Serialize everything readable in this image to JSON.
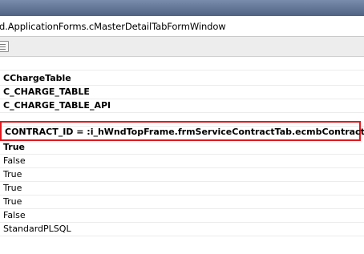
{
  "window": {
    "path": "d.ApplicationForms.cMasterDetailTabFormWindow"
  },
  "properties": {
    "rows_top": [
      {
        "value": "CChargeTable",
        "bold": true
      },
      {
        "value": "C_CHARGE_TABLE",
        "bold": true
      },
      {
        "value": "C_CHARGE_TABLE_API",
        "bold": true
      }
    ],
    "highlighted": "CONTRACT_ID = :i_hWndTopFrame.frmServiceContractTab.ecmbContractId",
    "rows_bottom": [
      {
        "value": "True",
        "bold": true
      },
      {
        "value": "False",
        "bold": false
      },
      {
        "value": "True",
        "bold": false
      },
      {
        "value": "True",
        "bold": false
      },
      {
        "value": "True",
        "bold": false
      },
      {
        "value": "False",
        "bold": false
      },
      {
        "value": "StandardPLSQL",
        "bold": false
      }
    ]
  },
  "colors": {
    "highlight_border": "#e0191f",
    "titlebar": "#5b6f8c"
  }
}
